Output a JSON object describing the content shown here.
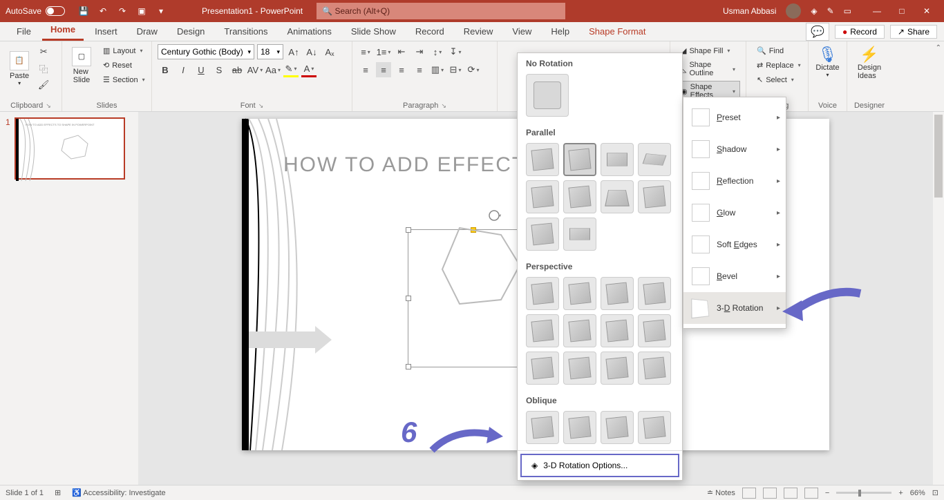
{
  "titlebar": {
    "autosave": "AutoSave",
    "title": "Presentation1 - PowerPoint",
    "search_placeholder": "Search (Alt+Q)",
    "user": "Usman Abbasi"
  },
  "tabs": {
    "file": "File",
    "home": "Home",
    "insert": "Insert",
    "draw": "Draw",
    "design": "Design",
    "transitions": "Transitions",
    "animations": "Animations",
    "slideshow": "Slide Show",
    "record": "Record",
    "review": "Review",
    "view": "View",
    "help": "Help",
    "shapeformat": "Shape Format",
    "record_btn": "Record",
    "share_btn": "Share"
  },
  "ribbon": {
    "clipboard": {
      "label": "Clipboard",
      "paste": "Paste"
    },
    "slides": {
      "label": "Slides",
      "newslide": "New\nSlide",
      "layout": "Layout",
      "reset": "Reset",
      "section": "Section"
    },
    "font": {
      "label": "Font",
      "name": "Century Gothic (Body)",
      "size": "18"
    },
    "paragraph": {
      "label": "Paragraph"
    },
    "drawing": {
      "shapefill": "Shape Fill",
      "shapeoutline": "Shape Outline",
      "shapeeffects": "Shape Effects"
    },
    "editing": {
      "label": "Editing",
      "find": "Find",
      "replace": "Replace",
      "select": "Select"
    },
    "voice": {
      "label": "Voice",
      "dictate": "Dictate"
    },
    "designer": {
      "label": "Designer",
      "ideas": "Design\nIdeas"
    }
  },
  "gallery": {
    "norotation": "No Rotation",
    "parallel": "Parallel",
    "perspective": "Perspective",
    "oblique": "Oblique",
    "options": "3-D Rotation Options..."
  },
  "submenu": {
    "preset": "Preset",
    "shadow": "Shadow",
    "reflection": "Reflection",
    "glow": "Glow",
    "softedges": "Soft Edges",
    "bevel": "Bevel",
    "rotation3d": "3-D Rotation"
  },
  "slide": {
    "title": "HOW TO ADD EFFECTS TO S",
    "thumb_title": "HOW TO ADD EFFECTS TO SHAPE IN POWERPOINT"
  },
  "statusbar": {
    "slide": "Slide 1 of 1",
    "accessibility": "Accessibility: Investigate",
    "notes": "Notes",
    "zoom": "66%"
  },
  "annotation": {
    "num": "6"
  }
}
